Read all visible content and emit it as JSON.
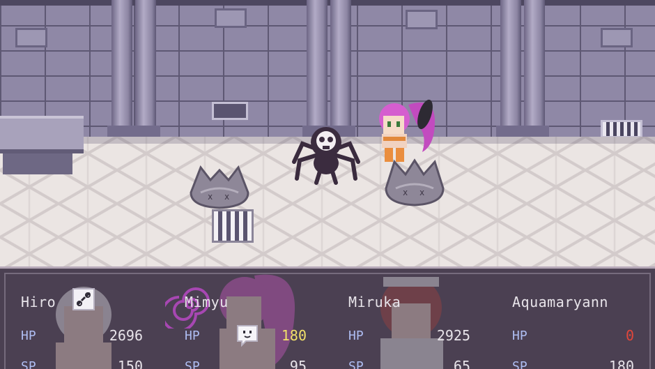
{
  "party": [
    {
      "name": "Hiro",
      "hp_label": "HP",
      "hp": "2696",
      "sp_label": "SP",
      "sp": "150",
      "hp_state": "normal",
      "state_icon": "bind-chain-icon"
    },
    {
      "name": "Mimyu",
      "hp_label": "HP",
      "hp": "180",
      "sp_label": "SP",
      "sp": "95",
      "hp_state": "warning",
      "state_icon": "speech-face-icon"
    },
    {
      "name": "Miruka",
      "hp_label": "HP",
      "hp": "2925",
      "sp_label": "SP",
      "sp": "65",
      "hp_state": "normal",
      "state_icon": ""
    },
    {
      "name": "Aquamaryann",
      "hp_label": "HP",
      "hp": "0",
      "sp_label": "SP",
      "sp": "180",
      "hp_state": "knocked-out",
      "state_icon": ""
    }
  ],
  "enemies": [
    "skull-spider",
    "gray-slime-left",
    "gray-slime-right"
  ],
  "colors": {
    "hp_warning": "#f2e06a",
    "hp_zero": "#e2463a",
    "stat_label": "#aebdf2",
    "window_bg": "#4e4254"
  }
}
